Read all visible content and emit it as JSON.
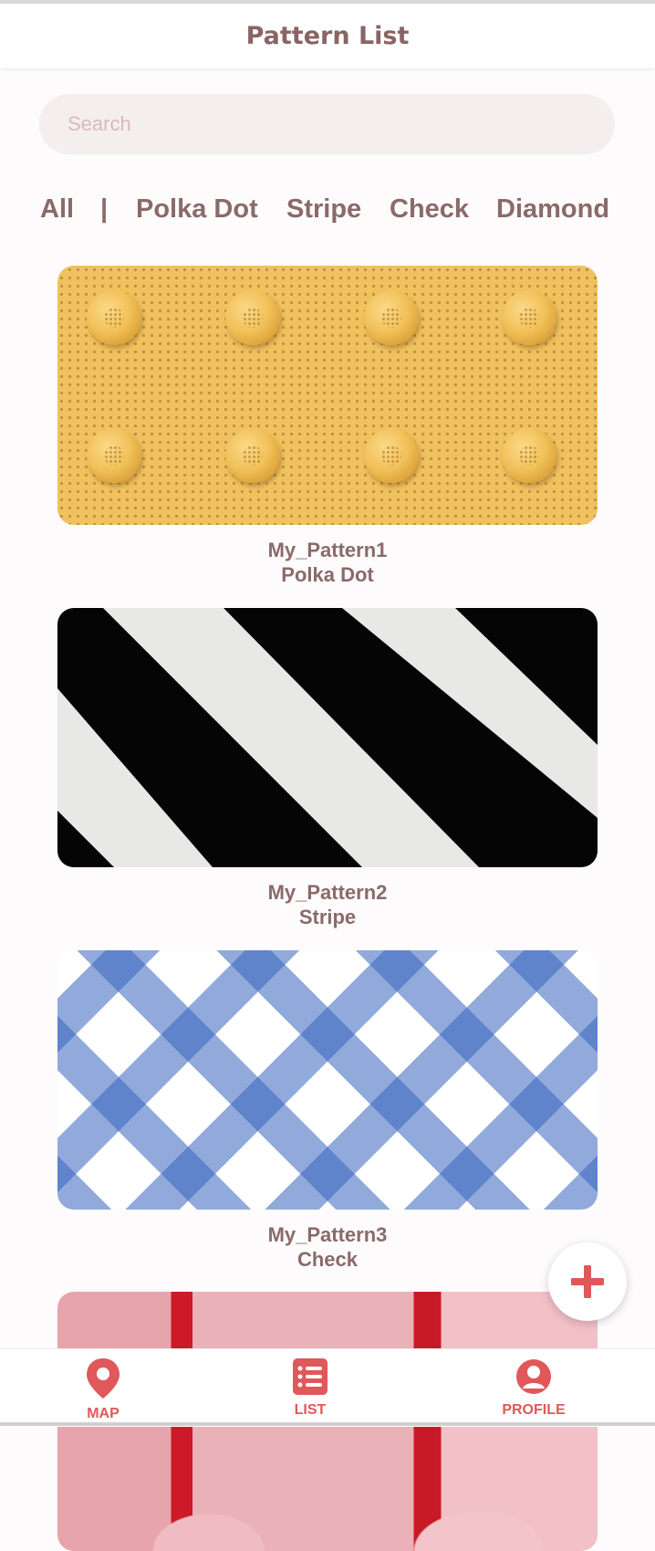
{
  "header": {
    "title": "Pattern List"
  },
  "search": {
    "placeholder": "Search",
    "value": ""
  },
  "filters": [
    "All",
    "|",
    "Polka Dot",
    "Stripe",
    "Check",
    "Diamond"
  ],
  "patterns": [
    {
      "name": "My_Pattern1",
      "type": "Polka Dot",
      "image": "yellow-tactile-dots"
    },
    {
      "name": "My_Pattern2",
      "type": "Stripe",
      "image": "black-white-diagonal-stripes"
    },
    {
      "name": "My_Pattern3",
      "type": "Check",
      "image": "blue-gingham-check"
    },
    {
      "name": "",
      "type": "",
      "image": "pink-red-pattern"
    }
  ],
  "fab": {
    "icon": "plus-icon"
  },
  "tabbar": {
    "items": [
      {
        "label": "MAP",
        "icon": "map-pin-icon"
      },
      {
        "label": "LIST",
        "icon": "list-icon"
      },
      {
        "label": "PROFILE",
        "icon": "profile-icon"
      }
    ]
  },
  "colors": {
    "accent": "#e0585a",
    "text": "#8a6a6a",
    "search_bg": "#f5eeee"
  }
}
